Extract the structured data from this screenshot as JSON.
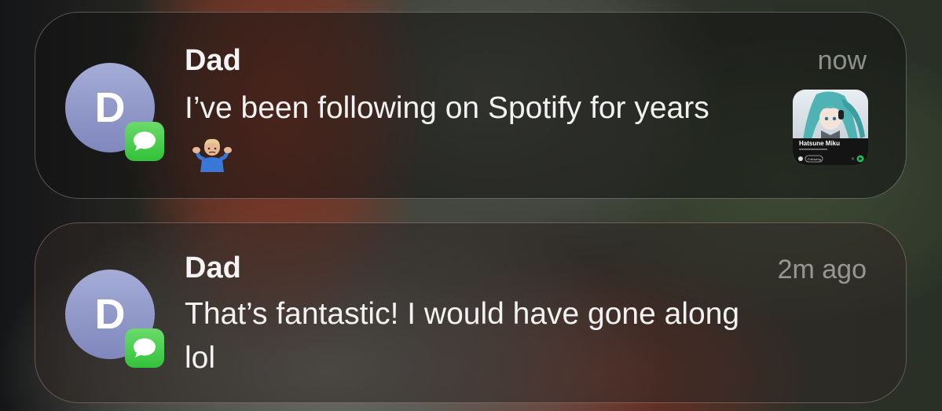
{
  "notifications": [
    {
      "sender": "Dad",
      "avatar_initial": "D",
      "time": "now",
      "message_text": "I’ve been following on Spotify for years",
      "emoji": "person-shrugging",
      "attachment": {
        "artist_label": "Hatsune Miku",
        "button_label": "Following"
      }
    },
    {
      "sender": "Dad",
      "avatar_initial": "D",
      "time": "2m ago",
      "message_text": "That’s fantastic! I would have gone along lol"
    }
  ],
  "colors": {
    "avatar": "#8f97c9",
    "messages_badge": "#4cd05a",
    "spotify_green": "#1db954"
  },
  "icons": {
    "app_badge": "messages-bubble-icon"
  }
}
